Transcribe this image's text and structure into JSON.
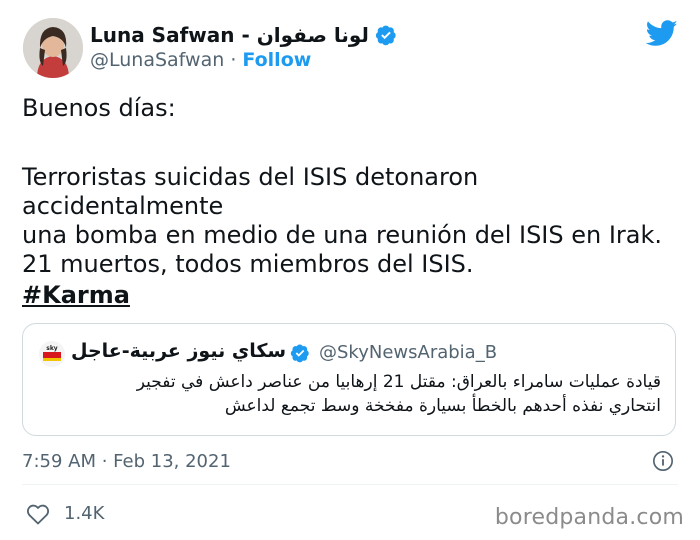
{
  "author": {
    "name": "Luna Safwan - لونا صفوان",
    "handle": "@LunaSafwan",
    "separator": "·",
    "follow_label": "Follow"
  },
  "tweet": {
    "greeting": "Buenos días:",
    "line1": "Terroristas suicidas del ISIS detonaron accidentalmente",
    "line2": "una bomba en medio de una reunión del ISIS en Irak.",
    "line3": "21 muertos, todos miembros del ISIS.",
    "hashtag": "#Karma"
  },
  "quoted": {
    "name": "سكاي نيوز عربية-عاجل",
    "handle": "@SkyNewsArabia_B",
    "text_line1": "قيادة عمليات سامراء بالعراق: مقتل 21 إرهابيا من عناصر داعش في تفجير",
    "text_line2": "انتحاري نفذه أحدهم بالخطأ بسيارة مفخخة وسط تجمع لداعش"
  },
  "meta": {
    "timestamp": "7:59 AM · Feb 13, 2021",
    "likes": "1.4K"
  },
  "watermark": "boredpanda.com",
  "icons": {
    "verified": "verified-badge-icon",
    "bird": "twitter-bird-icon",
    "info": "info-icon",
    "like": "heart-icon"
  },
  "colors": {
    "accent": "#1d9bf0",
    "text": "#0f1419",
    "muted": "#536471",
    "border": "#cfd9de"
  }
}
